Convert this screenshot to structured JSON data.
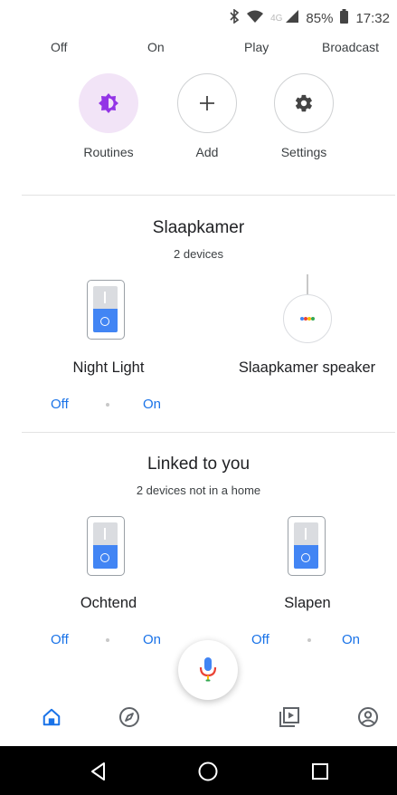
{
  "status_bar": {
    "network": "4G",
    "battery": "85%",
    "time": "17:32"
  },
  "quick_actions": [
    "Off",
    "On",
    "Play",
    "Broadcast"
  ],
  "shortcuts": {
    "routines": "Routines",
    "add": "Add",
    "settings": "Settings"
  },
  "room": {
    "title": "Slaapkamer",
    "subtitle": "2 devices",
    "devices": [
      {
        "name": "Night Light",
        "off": "Off",
        "on": "On"
      },
      {
        "name": "Slaapkamer speaker"
      }
    ]
  },
  "linked": {
    "title": "Linked to you",
    "subtitle": "2 devices not in a home",
    "devices": [
      {
        "name": "Ochtend",
        "off": "Off",
        "on": "On"
      },
      {
        "name": "Slapen",
        "off": "Off",
        "on": "On"
      }
    ]
  },
  "colors": {
    "accent": "#1a73e8",
    "routines_bg": "#f2e4f7",
    "routines_icon": "#9334e6",
    "switch_blue": "#4285f4"
  },
  "icons": {
    "status": [
      "bluetooth-icon",
      "data-saver-icon",
      "signal-icon",
      "battery-icon"
    ],
    "nav": [
      "home-icon",
      "explore-icon",
      "media-icon",
      "account-icon"
    ],
    "system": [
      "back-icon",
      "home-circle-icon",
      "recents-icon"
    ]
  }
}
